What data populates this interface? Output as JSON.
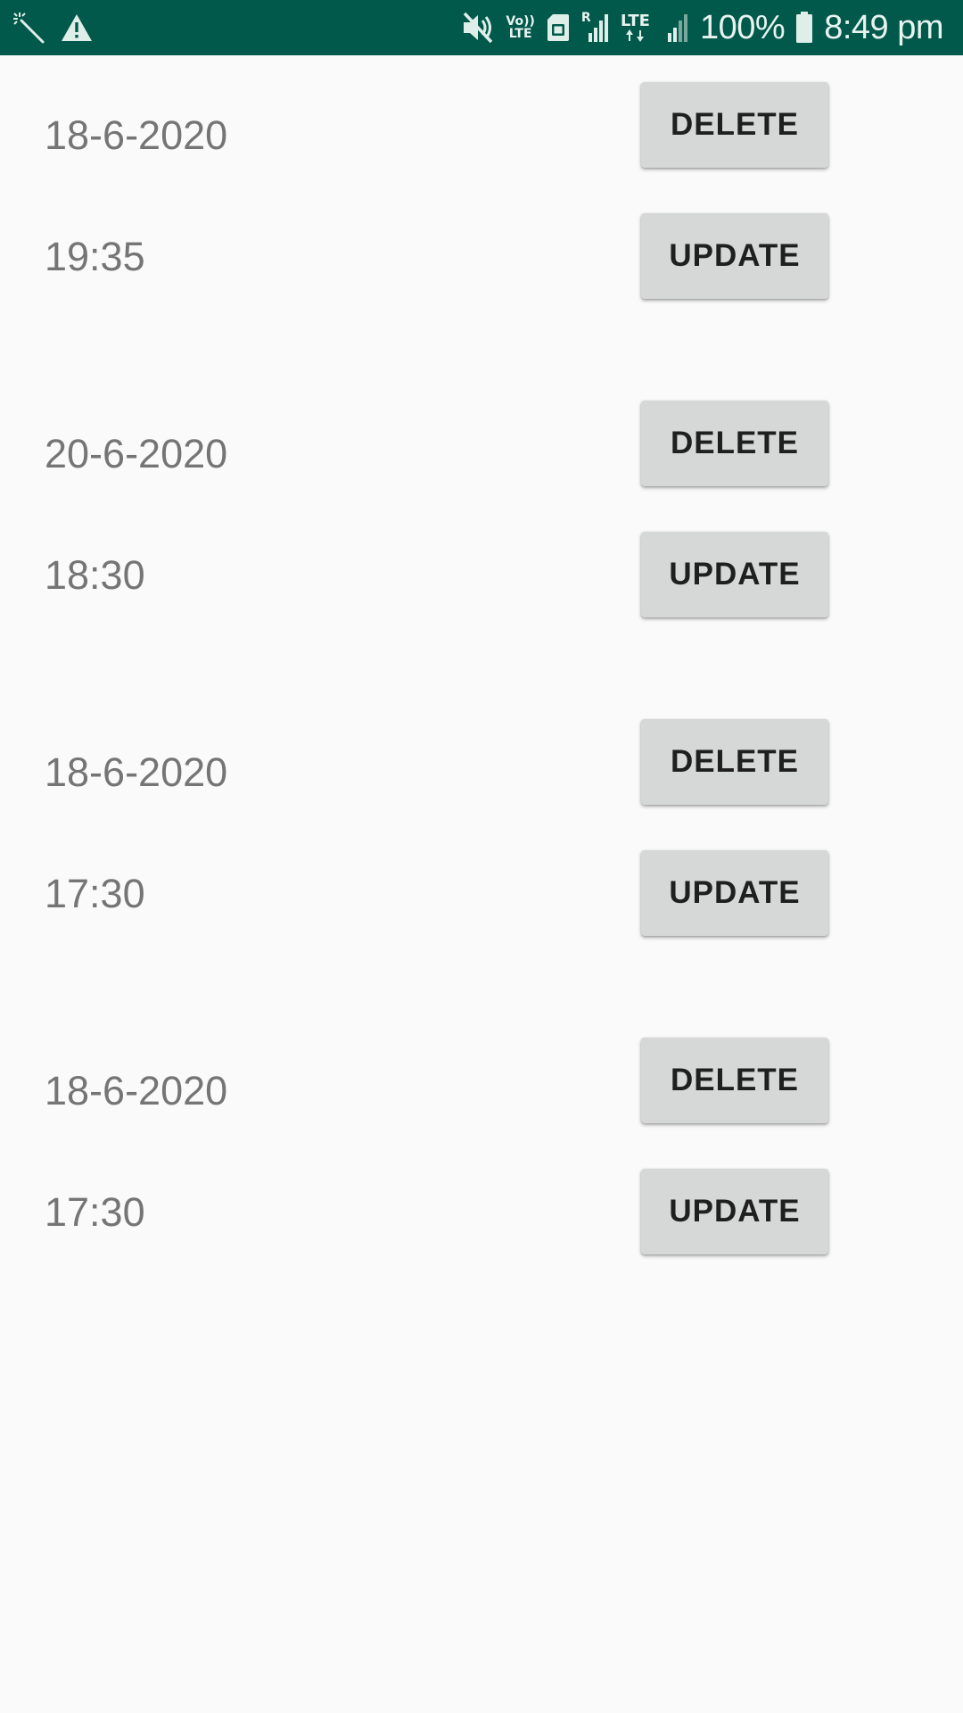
{
  "status_bar": {
    "icons_left": [
      "magic-wand-icon",
      "warning-icon"
    ],
    "icons_right": [
      "mute-icon",
      "volte-icon",
      "sim-card-icon",
      "signal-r-icon",
      "lte-data-icon",
      "signal-weak-icon",
      "battery-icon"
    ],
    "volte_label_top": "Vo))",
    "volte_label_bottom": "LTE",
    "signal_roaming_label": "R",
    "lte_label": "LTE",
    "battery_percent": "100%",
    "time": "8:49 pm",
    "background_color": "#00594a"
  },
  "entries": [
    {
      "date": "18-6-2020",
      "time": "19:35",
      "delete_label": "DELETE",
      "update_label": "UPDATE"
    },
    {
      "date": "20-6-2020",
      "time": "18:30",
      "delete_label": "DELETE",
      "update_label": "UPDATE"
    },
    {
      "date": "18-6-2020",
      "time": "17:30",
      "delete_label": "DELETE",
      "update_label": "UPDATE"
    },
    {
      "date": "18-6-2020",
      "time": "17:30",
      "delete_label": "DELETE",
      "update_label": "UPDATE"
    }
  ],
  "colors": {
    "page_background": "#fafafa",
    "label_text": "#757575",
    "button_background": "#d6d7d7",
    "button_text": "#1f1f1f"
  }
}
